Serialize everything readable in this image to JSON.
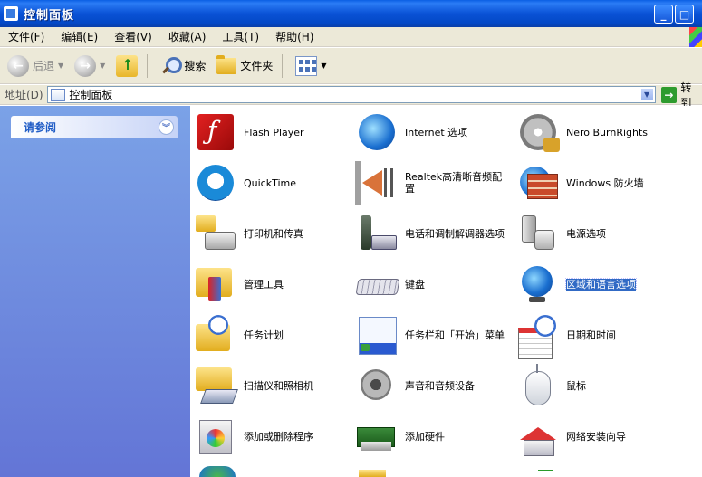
{
  "window": {
    "title": "控制面板",
    "min_label": "_",
    "max_label": "□"
  },
  "menubar": {
    "items": [
      "文件(F)",
      "编辑(E)",
      "查看(V)",
      "收藏(A)",
      "工具(T)",
      "帮助(H)"
    ]
  },
  "toolbar": {
    "back_label": "后退",
    "search_label": "搜索",
    "folders_label": "文件夹"
  },
  "addressbar": {
    "label": "地址(D)",
    "value": "控制面板",
    "go_label": "转到"
  },
  "sidebar": {
    "panel_title": "请参阅"
  },
  "items": [
    {
      "label": "Flash Player",
      "icon": "flash-icon"
    },
    {
      "label": "Internet 选项",
      "icon": "internet-options-icon"
    },
    {
      "label": "Nero BurnRights",
      "icon": "nero-burnrights-icon"
    },
    {
      "label": "QuickTime",
      "icon": "quicktime-icon"
    },
    {
      "label": "Realtek高清晰音频配置",
      "icon": "realtek-audio-icon"
    },
    {
      "label": "Windows 防火墙",
      "icon": "firewall-icon"
    },
    {
      "label": "打印机和传真",
      "icon": "printer-icon"
    },
    {
      "label": "电话和调制解调器选项",
      "icon": "phone-modem-icon"
    },
    {
      "label": "电源选项",
      "icon": "power-icon"
    },
    {
      "label": "管理工具",
      "icon": "admin-tools-icon"
    },
    {
      "label": "键盘",
      "icon": "keyboard-icon"
    },
    {
      "label": "区域和语言选项",
      "icon": "globe-icon",
      "selected": true
    },
    {
      "label": "任务计划",
      "icon": "scheduled-tasks-icon"
    },
    {
      "label": "任务栏和「开始」菜单",
      "icon": "taskbar-icon"
    },
    {
      "label": "日期和时间",
      "icon": "date-time-icon"
    },
    {
      "label": "扫描仪和照相机",
      "icon": "scanner-camera-icon"
    },
    {
      "label": "声音和音频设备",
      "icon": "sound-icon"
    },
    {
      "label": "鼠标",
      "icon": "mouse-icon"
    },
    {
      "label": "添加或删除程序",
      "icon": "add-remove-programs-icon"
    },
    {
      "label": "添加硬件",
      "icon": "add-hardware-icon"
    },
    {
      "label": "网络安装向导",
      "icon": "network-setup-icon"
    }
  ]
}
